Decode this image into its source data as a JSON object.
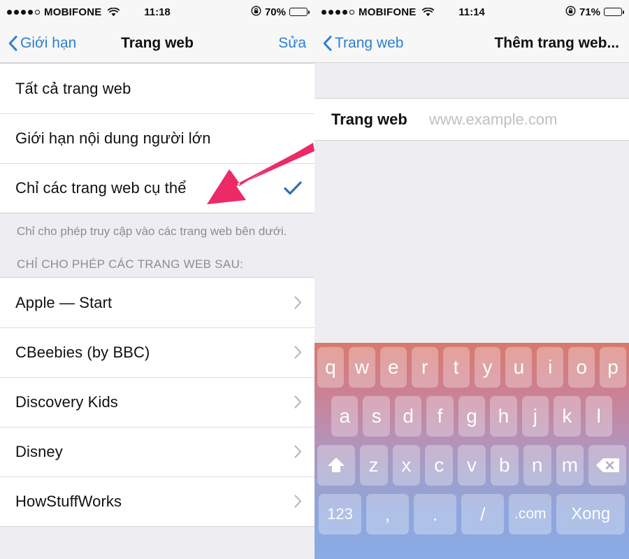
{
  "left_screen": {
    "status_bar": {
      "signal_dots_filled": 4,
      "signal_dots_total": 5,
      "carrier": "MOBIFONE",
      "wifi_icon": "wifi-icon",
      "time": "11:18",
      "lock_icon": "rotation-lock-icon",
      "battery_percent": "70%",
      "battery_level": 70
    },
    "nav": {
      "back_label": "Giới hạn",
      "back_icon": "chevron-left-icon",
      "title": "Trang web",
      "action_label": "Sửa"
    },
    "options": [
      {
        "label": "Tất cả trang web",
        "checked": false
      },
      {
        "label": "Giới hạn nội dung người lớn",
        "checked": false
      },
      {
        "label": "Chỉ các trang web cụ thể",
        "checked": true
      }
    ],
    "footnote": "Chỉ cho phép truy cập vào các trang web bên dưới.",
    "section_header": "CHỈ CHO PHÉP CÁC TRANG WEB SAU:",
    "sites": [
      {
        "label": "Apple — Start"
      },
      {
        "label": "CBeebies (by BBC)"
      },
      {
        "label": "Discovery Kids"
      },
      {
        "label": "Disney"
      },
      {
        "label": "HowStuffWorks"
      }
    ]
  },
  "right_screen": {
    "status_bar": {
      "signal_dots_filled": 4,
      "signal_dots_total": 5,
      "carrier": "MOBIFONE",
      "wifi_icon": "wifi-icon",
      "time": "11:14",
      "lock_icon": "rotation-lock-icon",
      "battery_percent": "71%",
      "battery_level": 71
    },
    "nav": {
      "back_label": "Trang web",
      "back_icon": "chevron-left-icon",
      "title": "Thêm trang web..."
    },
    "form": {
      "field_label": "Trang web",
      "field_value": "",
      "field_placeholder": "www.example.com"
    },
    "keyboard": {
      "row1": [
        "q",
        "w",
        "e",
        "r",
        "t",
        "y",
        "u",
        "i",
        "o",
        "p"
      ],
      "row2": [
        "a",
        "s",
        "d",
        "f",
        "g",
        "h",
        "j",
        "k",
        "l"
      ],
      "row3_shift_icon": "shift-up-arrow-icon",
      "row3": [
        "z",
        "x",
        "c",
        "v",
        "b",
        "n",
        "m"
      ],
      "row3_delete_icon": "backspace-delete-icon",
      "row4": [
        "123",
        ",",
        ".",
        "/",
        ".com",
        "Xong"
      ]
    }
  },
  "annotations": {
    "arrow_color": "#ec2a66",
    "left_arrow_target": "Chỉ các trang web cụ thể",
    "right_arrow_target": "www.example.com"
  },
  "colors": {
    "accent_blue": "#2b7fd4",
    "check_blue": "#2f6fb5",
    "background_gray": "#eeeef2",
    "arrow_pink": "#ec2a66"
  }
}
